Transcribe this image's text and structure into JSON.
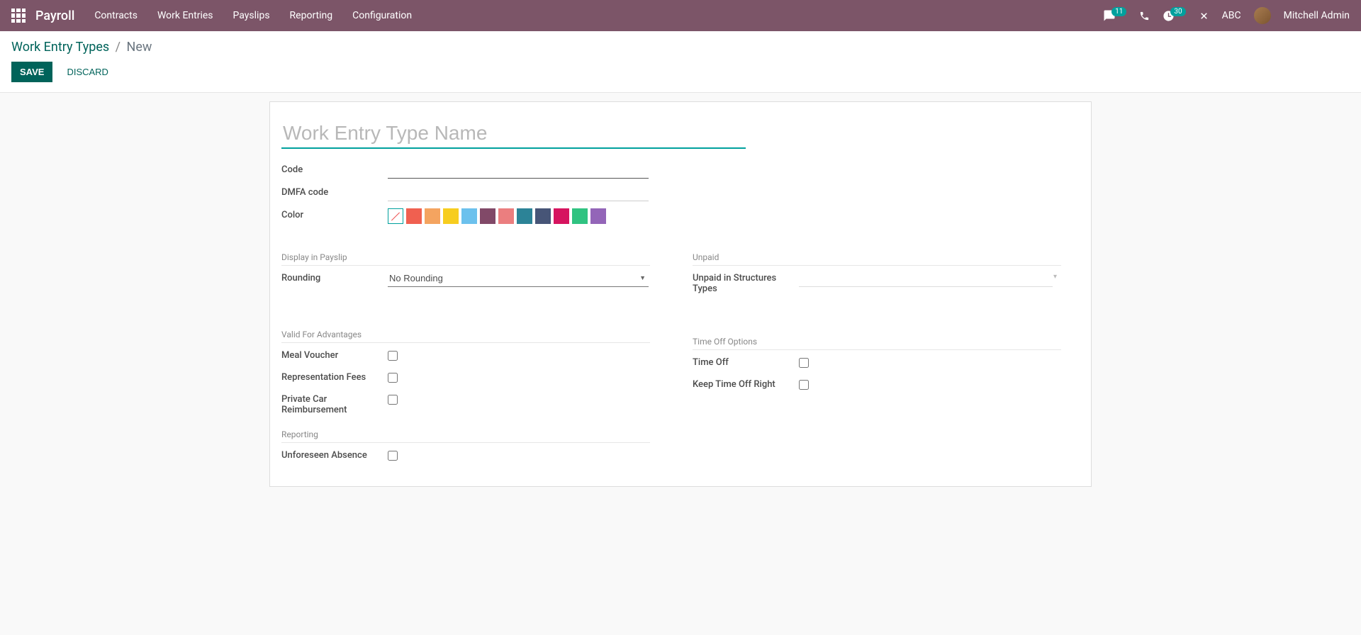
{
  "navbar": {
    "brand": "Payroll",
    "menu": [
      "Contracts",
      "Work Entries",
      "Payslips",
      "Reporting",
      "Configuration"
    ],
    "messages_badge": "11",
    "activities_badge": "30",
    "company": "ABC",
    "user": "Mitchell Admin"
  },
  "breadcrumb": {
    "parent": "Work Entry Types",
    "current": "New"
  },
  "buttons": {
    "save": "SAVE",
    "discard": "DISCARD"
  },
  "form": {
    "name_placeholder": "Work Entry Type Name",
    "labels": {
      "code": "Code",
      "dmfa": "DMFA code",
      "color": "Color",
      "rounding": "Rounding",
      "unpaid_struct": "Unpaid in Structures Types",
      "meal": "Meal Voucher",
      "rep_fees": "Representation Fees",
      "car": "Private Car Reimbursement",
      "timeoff": "Time Off",
      "keep_timeoff": "Keep Time Off Right",
      "unforeseen": "Unforeseen Absence"
    },
    "groups": {
      "display": "Display in Payslip",
      "unpaid": "Unpaid",
      "advantages": "Valid For Advantages",
      "timeoff_opts": "Time Off Options",
      "reporting": "Reporting"
    },
    "rounding_value": "No Rounding",
    "colors": [
      "#f06050",
      "#f4a460",
      "#f7cd1f",
      "#6cc1ed",
      "#814968",
      "#eb7e7f",
      "#2c8397",
      "#475577",
      "#d6145f",
      "#30c381",
      "#9365b8"
    ]
  }
}
